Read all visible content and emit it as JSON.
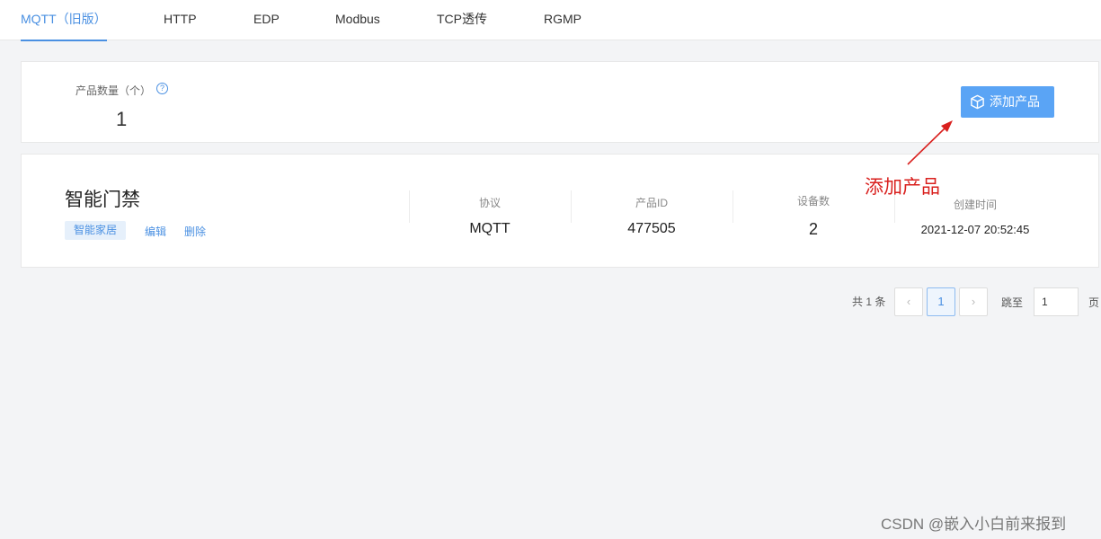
{
  "tabs": [
    {
      "label": "MQTT（旧版）",
      "active": true
    },
    {
      "label": "HTTP"
    },
    {
      "label": "EDP"
    },
    {
      "label": "Modbus"
    },
    {
      "label": "TCP透传"
    },
    {
      "label": "RGMP"
    }
  ],
  "summary": {
    "label": "产品数量（个）",
    "help_icon": "?",
    "value": "1",
    "add_button": "添加产品"
  },
  "product": {
    "name": "智能门禁",
    "tag": "智能家居",
    "edit_link": "编辑",
    "delete_link": "删除",
    "stats": [
      {
        "label": "协议",
        "value": "MQTT"
      },
      {
        "label": "产品ID",
        "value": "477505"
      },
      {
        "label": "设备数",
        "value": "2"
      },
      {
        "label": "创建时间",
        "value": "2021-12-07 20:52:45"
      }
    ]
  },
  "pagination": {
    "total": "共 1 条",
    "prev": "‹",
    "current": "1",
    "next": "›",
    "jump_label": "跳至",
    "jump_value": "1",
    "page_label": "页"
  },
  "annotation": "添加产品",
  "watermark": "CSDN @嵌入小白前来报到",
  "colors": {
    "accent": "#4a90e2",
    "button": "#5aa4f5",
    "annotation": "#d9201e",
    "background": "#f3f4f6"
  }
}
